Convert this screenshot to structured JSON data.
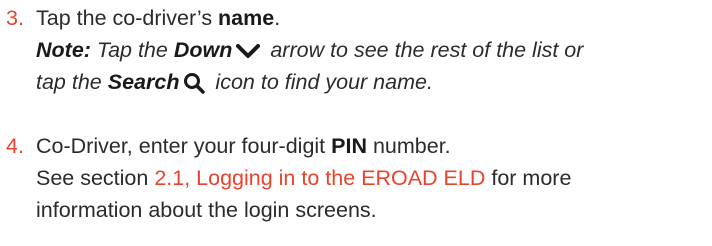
{
  "steps": [
    {
      "number": "3.",
      "line1": {
        "pre": "Tap the co-driver’s ",
        "bold": "name",
        "post": "."
      },
      "note": {
        "label": "Note:",
        "part1": " Tap the ",
        "down_bold": "Down",
        "part2": " arrow to see the rest of the list or",
        "line3_pre": "tap the ",
        "search_bold": "Search",
        "line3_post": " icon to find your name."
      },
      "icons": {
        "down": "chevron-down-icon",
        "search": "search-icon"
      }
    },
    {
      "number": "4.",
      "line1": {
        "pre": "Co-Driver, enter your four-digit ",
        "bold": "PIN",
        "post": " number."
      },
      "line2": {
        "pre": "See section ",
        "link": "2.1, Logging in to the EROAD ELD",
        "post": " for more"
      },
      "line3": "information about the login screens."
    }
  ],
  "colors": {
    "accent": "#e8432c",
    "text": "#2b2b2b"
  }
}
